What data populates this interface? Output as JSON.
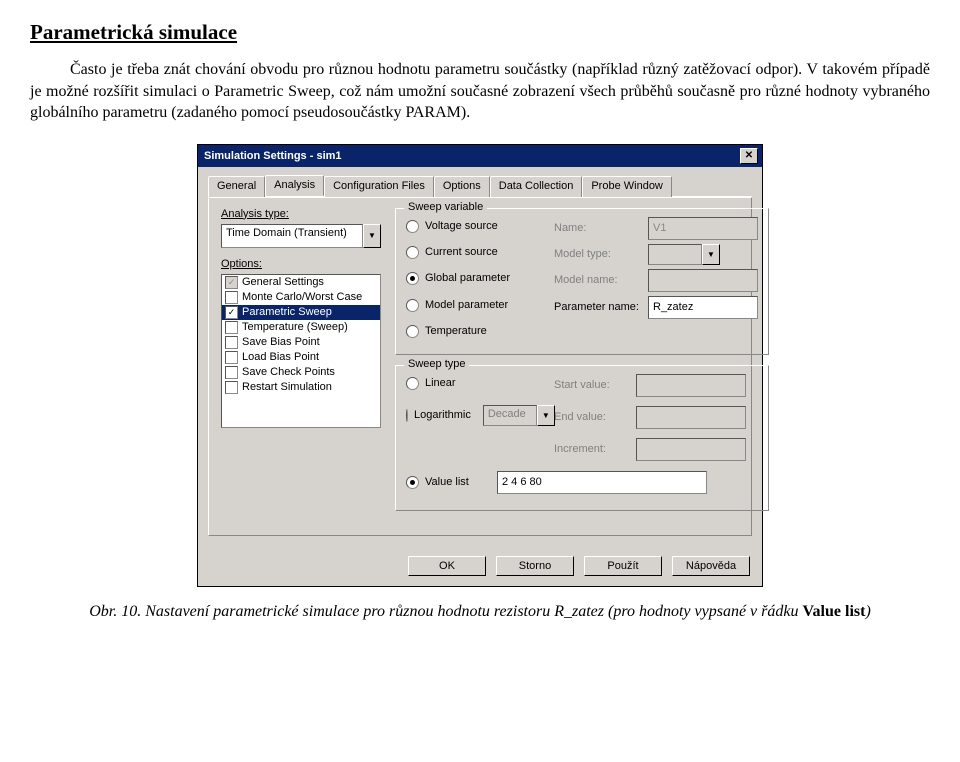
{
  "title": "Parametrická simulace",
  "paragraph_parts": {
    "p1": "Často je třeba znát chování obvodu pro různou hodnotu parametru součástky (například různý zatěžovací odpor). V takovém případě je možné rozšířit simulaci o Parametric Sweep, což nám umožní současné zobrazení všech průběhů současně pro různé hodnoty vybraného globálního parametru (zadaného pomocí pseudosoučástky PARAM)."
  },
  "dialog": {
    "window_title": "Simulation Settings - sim1",
    "tabs": [
      "General",
      "Analysis",
      "Configuration Files",
      "Options",
      "Data Collection",
      "Probe Window"
    ],
    "active_tab_index": 1,
    "analysis_type_label": "Analysis type:",
    "analysis_type_value": "Time Domain (Transient)",
    "options_label": "Options:",
    "options_list": [
      {
        "label": "General Settings",
        "checked": true,
        "disabled": true
      },
      {
        "label": "Monte Carlo/Worst Case",
        "checked": false
      },
      {
        "label": "Parametric Sweep",
        "checked": true,
        "selected": true
      },
      {
        "label": "Temperature (Sweep)",
        "checked": false
      },
      {
        "label": "Save Bias Point",
        "checked": false
      },
      {
        "label": "Load Bias Point",
        "checked": false
      },
      {
        "label": "Save Check Points",
        "checked": false
      },
      {
        "label": "Restart Simulation",
        "checked": false
      }
    ],
    "sweep_variable": {
      "group": "Sweep variable",
      "radios": [
        "Voltage source",
        "Current source",
        "Global parameter",
        "Model parameter",
        "Temperature"
      ],
      "selected_index": 2,
      "fields": {
        "name_label": "Name:",
        "name_value": "V1",
        "model_type_label": "Model type:",
        "model_name_label": "Model name:",
        "param_name_label": "Parameter name:",
        "param_name_value": "R_zatez"
      }
    },
    "sweep_type": {
      "group": "Sweep type",
      "radios": [
        "Linear",
        "Logarithmic",
        "Value list"
      ],
      "selected_index": 2,
      "log_scale": "Decade",
      "start_label": "Start value:",
      "end_label": "End value:",
      "inc_label": "Increment:",
      "value_list": "2 4 6 80"
    },
    "buttons": [
      "OK",
      "Storno",
      "Použít",
      "Nápověda"
    ]
  },
  "caption_parts": {
    "pre": "Obr. 10. ",
    "mid": "Nastavení parametrické simulace pro různou hodnotu rezistoru R_zatez (pro hodnoty vypsané v řádku ",
    "bold": "Value list",
    "post": ")"
  }
}
